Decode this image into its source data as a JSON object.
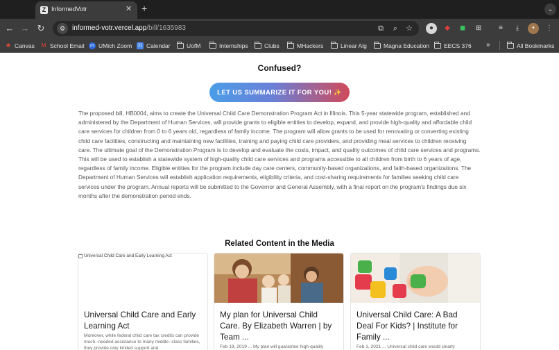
{
  "browser": {
    "tab": {
      "title": "InformedVotr",
      "favicon": "Z"
    },
    "url": {
      "host": "informed-votr.vercel.app",
      "path": "/bill/1635983"
    },
    "bookmarks": [
      {
        "label": "Canvas",
        "icon": "canvas-icon"
      },
      {
        "label": "School Email",
        "icon": "gmail-icon"
      },
      {
        "label": "UMich Zoom",
        "icon": "zoom-icon"
      },
      {
        "label": "Calendar",
        "icon": "calendar-icon"
      },
      {
        "label": "UofM",
        "icon": "folder-icon"
      },
      {
        "label": "Internships",
        "icon": "folder-icon"
      },
      {
        "label": "Clubs",
        "icon": "folder-icon"
      },
      {
        "label": "MHackers",
        "icon": "folder-icon"
      },
      {
        "label": "Linear Alg",
        "icon": "folder-icon"
      },
      {
        "label": "Magna Education",
        "icon": "folder-icon"
      },
      {
        "label": "EECS 376",
        "icon": "folder-icon"
      }
    ],
    "all_bookmarks": "All Bookmarks"
  },
  "page": {
    "confused_heading": "Confused?",
    "summarize_button": "LET US SUMMARIZE IT FOR YOU!",
    "summary": "The proposed bill, HB0004, aims to create the Universal Child Care Demonstration Program Act in Illinois. This 5-year statewide program, established and administered by the Department of Human Services, will provide grants to eligible entities to develop, expand, and provide high-quality and affordable child care services for children from 0 to 6 years old, regardless of family income. The program will allow grants to be used for renovating or converting existing child care facilities, constructing and maintaining new facilities, training and paying child care providers, and providing meal services to children receiving care. The ultimate goal of the Demonstration Program is to develop and evaluate the costs, impact, and quality outcomes of child care services and programs. This will be used to establish a statewide system of high-quality child care services and programs accessible to all children from birth to 6 years of age, regardless of family income. Eligible entities for the program include day care centers, community-based organizations, and faith-based organizations. The Department of Human Services will establish application requirements, eligibility criteria, and cost-sharing requirements for families seeking child care services under the program. Annual reports will be submitted to the Governor and General Assembly, with a final report on the program's findings due six months after the demonstration period ends.",
    "related_heading": "Related Content in the Media",
    "cards": [
      {
        "image_alt": "Universal Child Care and Early Learning Act",
        "title": "Universal Child Care and Early Learning Act",
        "snippet": "Moreover, while federal child care tax credits can provide much--needed assistance to many middle--class families, they provide only limited support and"
      },
      {
        "image_alt": "",
        "title": "My plan for Universal Child Care. By Elizabeth Warren | by Team ...",
        "snippet": "Feb 19, 2019 ... My plan will guarantee high-quality"
      },
      {
        "image_alt": "",
        "title": "Universal Child Care: A Bad Deal For Kids? | Institute for Family ...",
        "snippet": "Feb 1, 2021 ... Universal child care would clearly"
      }
    ]
  }
}
